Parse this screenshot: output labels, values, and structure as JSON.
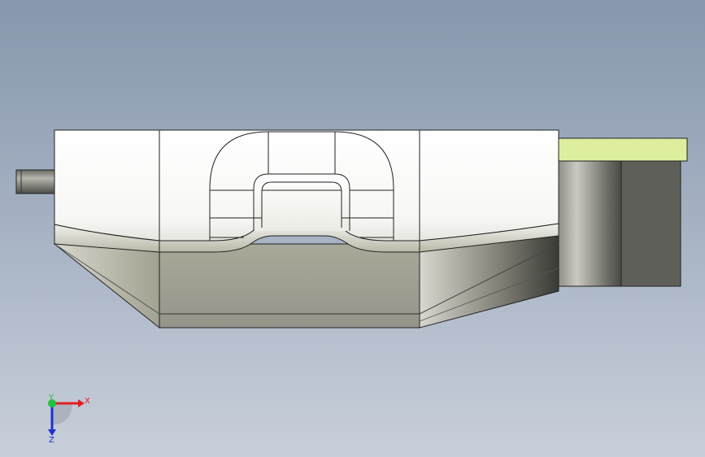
{
  "viewport": {
    "background_top": "#8797ad",
    "background_bottom": "#c8cfda"
  },
  "model": {
    "top_face_color": "#ffffff",
    "side_face_color": "#9c9c8a",
    "edge_color": "#1a1a1a",
    "tab_color": "#ddef9f",
    "block_color": "#5f5f59"
  },
  "triad": {
    "x_label": "X",
    "y_label": "Y",
    "z_label": "Z",
    "x_color": "#e02020",
    "y_color": "#20c040",
    "z_color": "#2030d0"
  }
}
